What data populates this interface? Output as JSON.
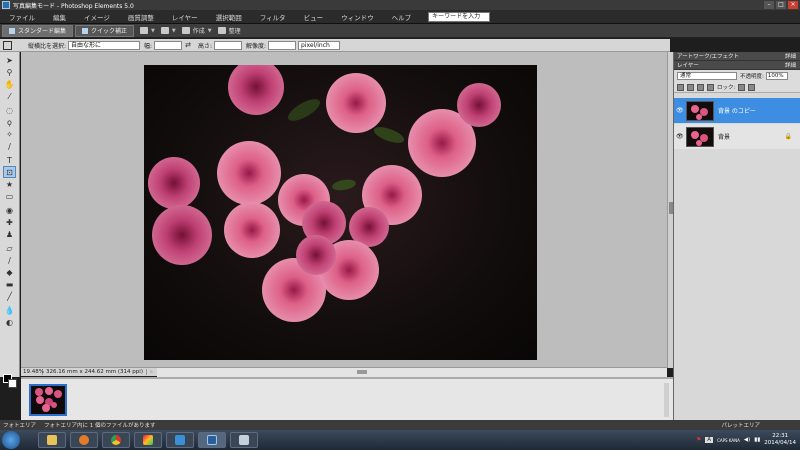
{
  "window": {
    "title": "写真編集モード - Photoshop Elements 5.0"
  },
  "menu": {
    "items": [
      "ファイル",
      "編集",
      "イメージ",
      "画質調整",
      "レイヤー",
      "選択範囲",
      "フィルタ",
      "ビュー",
      "ウィンドウ",
      "ヘルプ"
    ],
    "search_placeholder": "キーワードを入力"
  },
  "modebar": {
    "standard_label": "スタンダード編集",
    "quick_label": "クイック補正",
    "create_label": "作成",
    "organize_label": "整理"
  },
  "options": {
    "ratio_label": "縦横比を選択:",
    "ratio_value": "自由な形に",
    "width_label": "幅:",
    "height_label": "高さ:",
    "resolution_label": "解像度:",
    "unit_value": "pixel/inch"
  },
  "status": {
    "zoom": "19.48%",
    "doc_info": "326.16 mm x 244.62 mm (314 ppi)"
  },
  "photobar": {
    "label": "フォトエリア",
    "info": "フォトエリア内に 1 個のファイルがあります",
    "palette_label": "パレットエリア"
  },
  "panels": {
    "artwork_title": "アートワーク/エフェクト",
    "layers_title": "レイヤー",
    "detail_label": "詳細",
    "blend_mode": "通常",
    "opacity_label": "不透明度:",
    "opacity_value": "100%",
    "lock_label": "ロック:",
    "layers": [
      {
        "name": "背景 のコピー",
        "selected": true
      },
      {
        "name": "背景",
        "selected": false
      }
    ]
  },
  "taskbar": {
    "ime_label": "CAPS KANA",
    "time": "22:31",
    "date": "2014/04/14"
  },
  "colors": {
    "accent": "#3d8ee3",
    "flower_pink": "#e8648f",
    "background_dark": "#140e0e"
  }
}
